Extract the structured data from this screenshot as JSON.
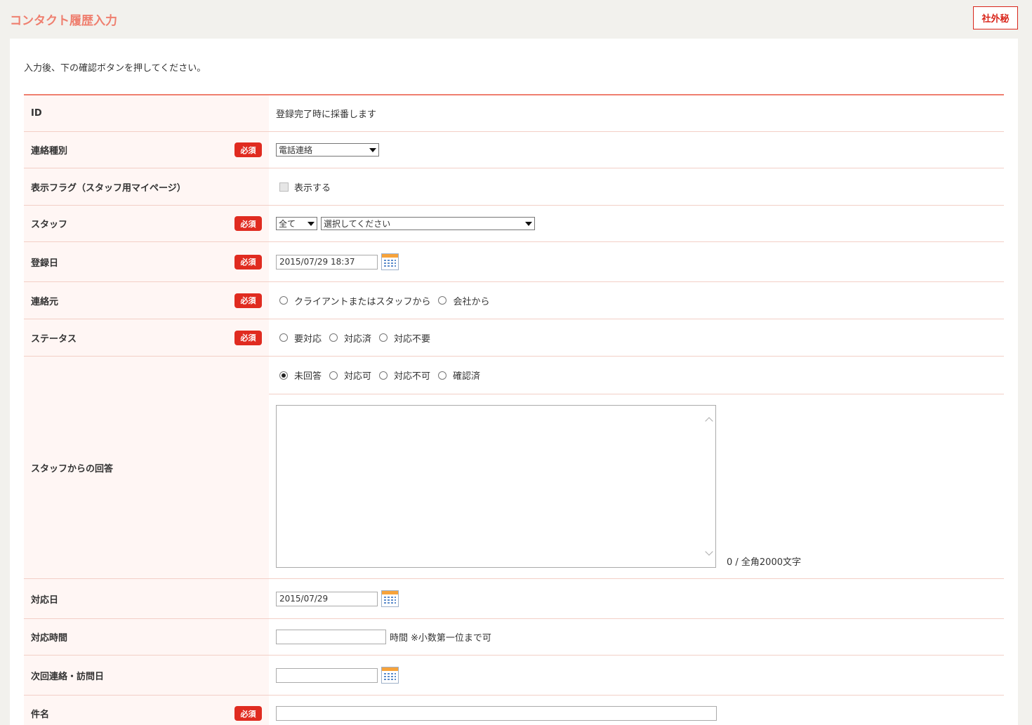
{
  "header": {
    "title": "コンタクト履歴入力",
    "badge": "社外秘"
  },
  "instruction": "入力後、下の確認ボタンを押してください。",
  "required_label": "必須",
  "fields": {
    "id": {
      "label": "ID",
      "value": "登録完了時に採番します"
    },
    "contact_type": {
      "label": "連絡種別",
      "value": "電話連絡"
    },
    "display_flag": {
      "label": "表示フラグ（スタッフ用マイページ）",
      "option": "表示する",
      "checked": false
    },
    "staff": {
      "label": "スタッフ",
      "filter_value": "全て",
      "value": "選択してください"
    },
    "registered_date": {
      "label": "登録日",
      "value": "2015/07/29 18:37"
    },
    "contact_source": {
      "label": "連絡元",
      "options": [
        "クライアントまたはスタッフから",
        "会社から"
      ],
      "selected": null
    },
    "status": {
      "label": "ステータス",
      "options": [
        "要対応",
        "対応済",
        "対応不要"
      ],
      "selected": null
    },
    "staff_reply": {
      "label": "スタッフからの回答",
      "options": [
        "未回答",
        "対応可",
        "対応不可",
        "確認済"
      ],
      "selected": "未回答",
      "text": "",
      "counter": "0 / 全角2000文字"
    },
    "response_date": {
      "label": "対応日",
      "value": "2015/07/29"
    },
    "response_time": {
      "label": "対応時間",
      "value": "",
      "unit": "時間",
      "note": "※小数第一位まで可"
    },
    "next_contact": {
      "label": "次回連絡・訪問日",
      "value": ""
    },
    "subject": {
      "label": "件名",
      "value": ""
    }
  }
}
